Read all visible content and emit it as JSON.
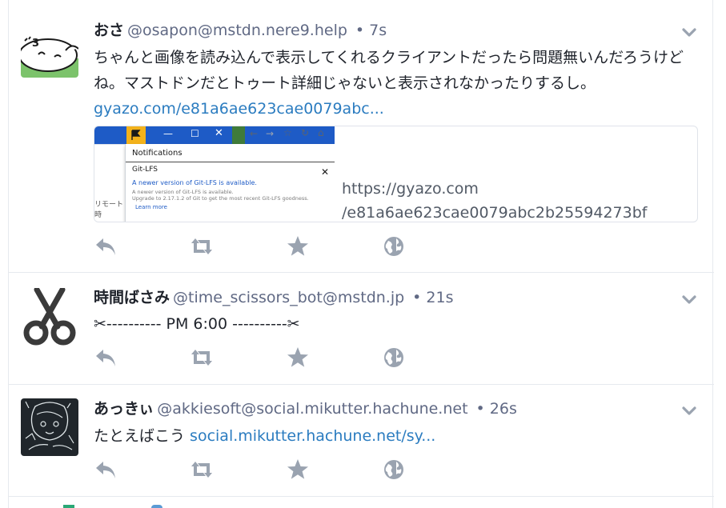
{
  "colors": {
    "accent": "#2b7cc0",
    "icon": "#9aa3b0",
    "muted": "#606984"
  },
  "statuses": [
    {
      "display_name": "おさ",
      "acct": "@osapon@mstdn.nere9.help",
      "time": "• 7s",
      "content": "ちゃんと画像を読み込んで表示してくれるクライアントだったら問題無いんだろうけどね。マストドンだとトゥート詳細じゃないと表示されなかったりするし。",
      "link": "gyazo.com/e81a6ae623cae0079abc...",
      "avatar_icon": "rice-cake-face-icon",
      "card": {
        "url_line1": "https://gyazo.com",
        "url_line2": "/e81a6ae623cae0079abc2b25594273bf",
        "thumb": {
          "panel_title": "Notifications",
          "item_title": "Git-LFS",
          "message": "A newer version of Git-LFS is available.",
          "detail1": "A newer version of Git-LFS is available.",
          "detail2": "Upgrade to 2.17.1.2 of Git to get the most recent Git-LFS goodness.",
          "learn": "Learn more",
          "side1": "リモート",
          "side2": "時"
        }
      }
    },
    {
      "display_name": "時間ばさみ",
      "acct": "@time_scissors_bot@mstdn.jp",
      "time": "• 21s",
      "content": "✂---------- PM 6:00 ----------✂",
      "avatar_icon": "scissors-icon"
    },
    {
      "display_name": "あっきぃ",
      "acct": "@akkiesoft@social.mikutter.hachune.net",
      "time": "• 26s",
      "content_prefix": "たとえばこう ",
      "link": "social.mikutter.hachune.net/sy...",
      "avatar_icon": "chalk-drawing-icon"
    }
  ],
  "actions": [
    "reply-icon",
    "boost-icon",
    "favourite-icon",
    "globe-icon"
  ]
}
